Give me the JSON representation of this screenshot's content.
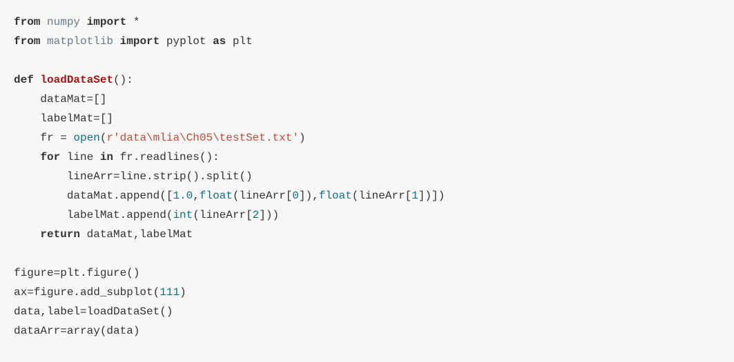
{
  "code": {
    "l1_from": "from",
    "l1_mod": "numpy",
    "l1_import": "import",
    "l1_star": "*",
    "l2_from": "from",
    "l2_mod": "matplotlib",
    "l2_import": "import",
    "l2_pyplot": "pyplot",
    "l2_as": "as",
    "l2_plt": "plt",
    "l4_def": "def",
    "l4_fn": "loadDataSet",
    "l4_paren": "():",
    "l5": "    dataMat=[]",
    "l6": "    labelMat=[]",
    "l7_prefix": "    fr = ",
    "l7_open": "open",
    "l7_lparen": "(",
    "l7_str": "r'data\\mlia\\Ch05\\testSet.txt'",
    "l7_rparen": ")",
    "l8_indent": "    ",
    "l8_for": "for",
    "l8_line": " line ",
    "l8_in": "in",
    "l8_rest": " fr.readlines():",
    "l9": "        lineArr=line.strip().split()",
    "l10_prefix": "        dataMat.append([",
    "l10_n1": "1.0",
    "l10_c1": ",",
    "l10_float1": "float",
    "l10_p1": "(lineArr[",
    "l10_i0": "0",
    "l10_p2": "]),",
    "l10_float2": "float",
    "l10_p3": "(lineArr[",
    "l10_i1": "1",
    "l10_p4": "])])",
    "l11_prefix": "        labelMat.append(",
    "l11_int": "int",
    "l11_p1": "(lineArr[",
    "l11_i2": "2",
    "l11_p2": "]))",
    "l12_indent": "    ",
    "l12_return": "return",
    "l12_rest": " dataMat,labelMat",
    "l14": "figure=plt.figure()",
    "l15_prefix": "ax=figure.add_subplot(",
    "l15_num": "111",
    "l15_suffix": ")",
    "l16": "data,label=loadDataSet()",
    "l17": "dataArr=array(data)"
  }
}
